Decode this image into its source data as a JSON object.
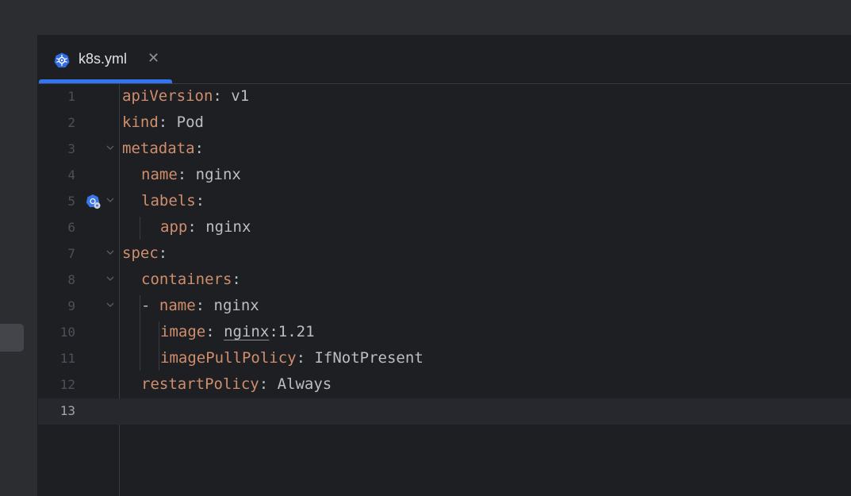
{
  "tab": {
    "label": "k8s.yml",
    "icon": "kubernetes-icon",
    "close_icon": "close-icon",
    "active": true
  },
  "accent_color": "#3574f0",
  "lines": [
    {
      "n": "1",
      "key": "apiVersion",
      "sep": ":",
      "value": " v1"
    },
    {
      "n": "2",
      "key": "kind",
      "sep": ":",
      "value": " Pod"
    },
    {
      "n": "3",
      "key": "metadata",
      "sep": ":",
      "value": ""
    },
    {
      "n": "4",
      "key": "name",
      "sep": ":",
      "value": " nginx"
    },
    {
      "n": "5",
      "key": "labels",
      "sep": ":",
      "value": ""
    },
    {
      "n": "6",
      "key": "app",
      "sep": ":",
      "value": " nginx"
    },
    {
      "n": "7",
      "key": "spec",
      "sep": ":",
      "value": ""
    },
    {
      "n": "8",
      "key": "containers",
      "sep": ":",
      "value": ""
    },
    {
      "n": "9",
      "dash": "- ",
      "key": "name",
      "sep": ":",
      "value": " nginx"
    },
    {
      "n": "10",
      "key": "image",
      "sep": ":",
      "value_pre": " ",
      "value_link": "nginx",
      "value_post": ":1.21"
    },
    {
      "n": "11",
      "key": "imagePullPolicy",
      "sep": ":",
      "value": " IfNotPresent"
    },
    {
      "n": "12",
      "key": "restartPolicy",
      "sep": ":",
      "value": " Always"
    },
    {
      "n": "13",
      "key": "",
      "sep": "",
      "value": ""
    }
  ],
  "gutter_icon": "kubernetes-label-icon",
  "fold_icon": "chevron-down-icon"
}
